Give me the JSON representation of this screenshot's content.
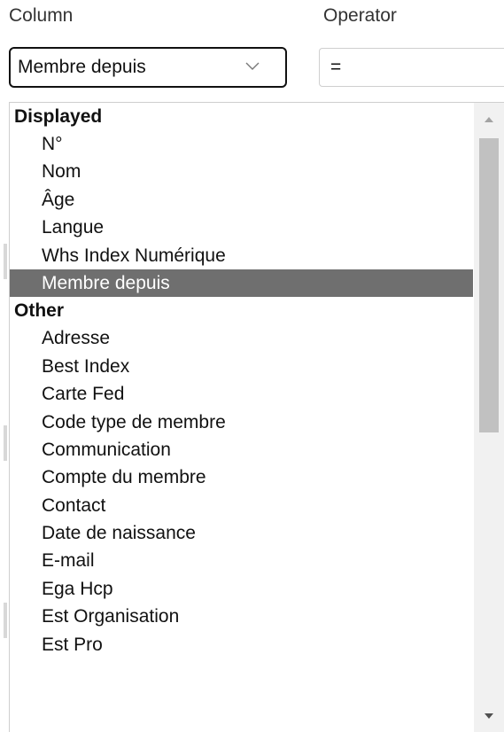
{
  "filter": {
    "column_label": "Column",
    "operator_label": "Operator",
    "column_value": "Membre depuis",
    "operator_value": "="
  },
  "dropdown": {
    "groups": [
      {
        "label": "Displayed",
        "options": [
          "N°",
          "Nom",
          "Âge",
          "Langue",
          "Whs Index Numérique",
          "Membre depuis"
        ]
      },
      {
        "label": "Other",
        "options": [
          "Adresse",
          "Best Index",
          "Carte Fed",
          "Code type de membre",
          "Communication",
          "Compte du membre",
          "Contact",
          "Date de naissance",
          "E-mail",
          "Ega Hcp",
          "Est Organisation",
          "Est Pro"
        ]
      }
    ],
    "selected": "Membre depuis"
  },
  "icons": {
    "select_chevron": "chevron-down-icon",
    "scroll_up": "scroll-up-arrow-icon",
    "scroll_down": "scroll-down-arrow-icon"
  },
  "colors": {
    "selected_bg": "#6f6f6f",
    "selected_fg": "#ffffff"
  }
}
